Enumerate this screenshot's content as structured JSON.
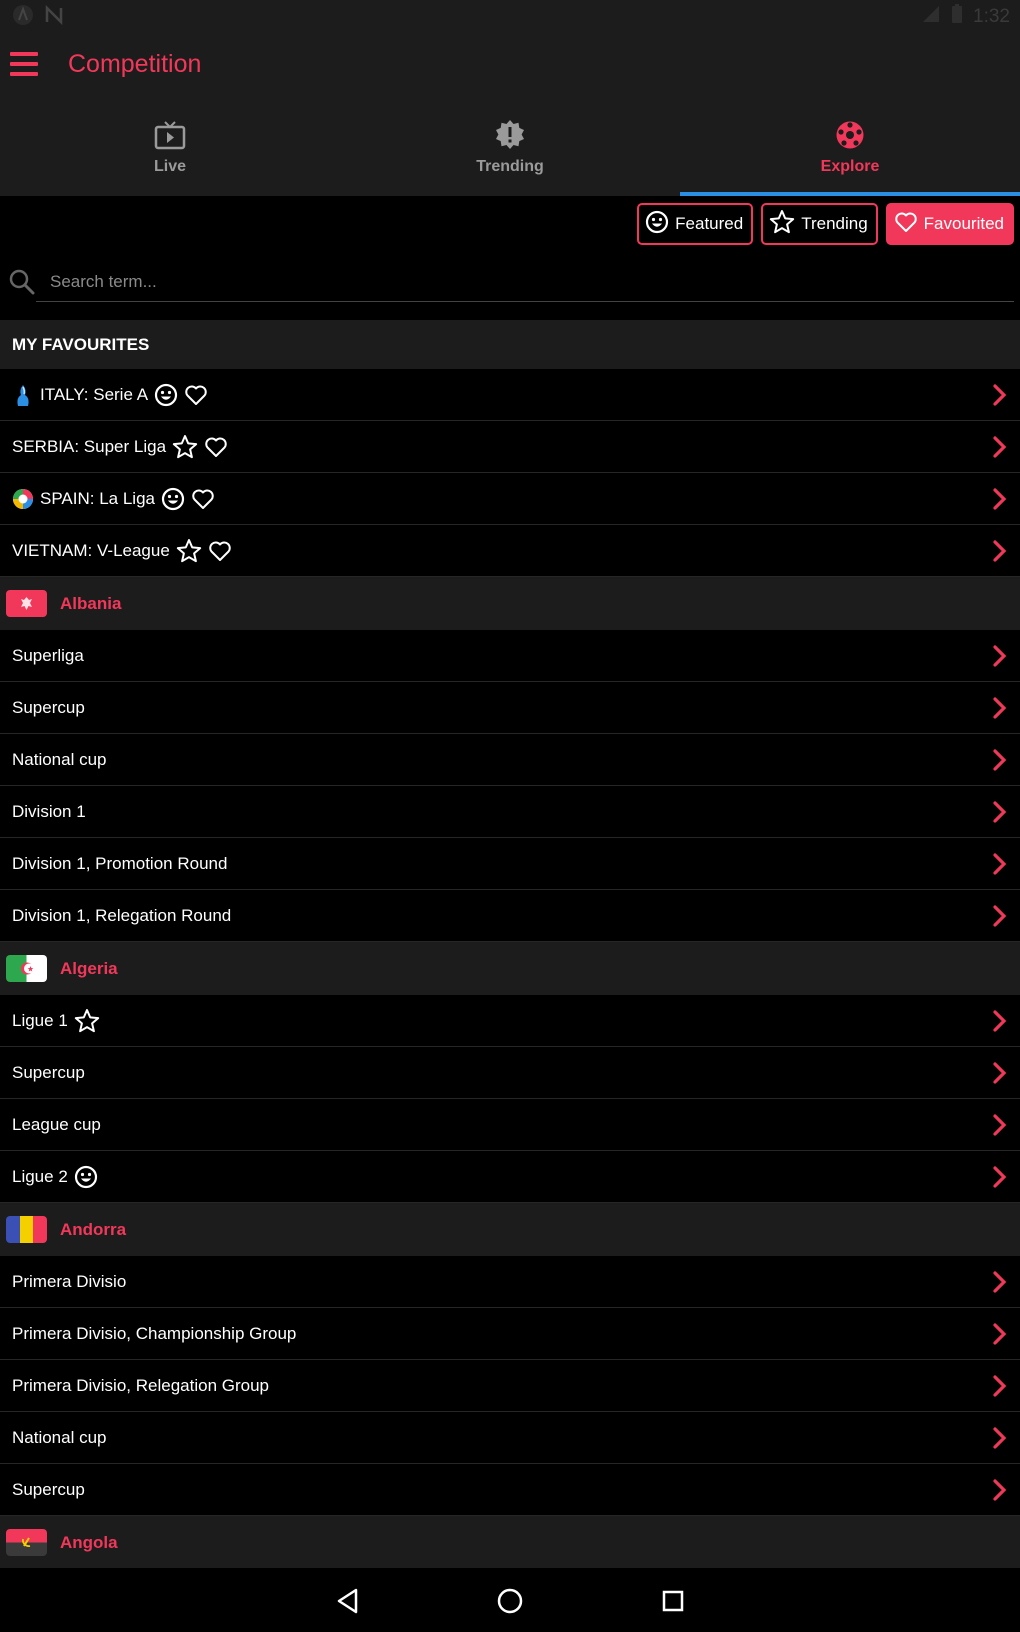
{
  "status_bar": {
    "time": "1:32"
  },
  "app_bar": {
    "title": "Competition"
  },
  "tabs": [
    {
      "label": "Live",
      "icon": "tv-icon"
    },
    {
      "label": "Trending",
      "icon": "alert-badge-icon"
    },
    {
      "label": "Explore",
      "icon": "soccer-ball-icon",
      "active": true
    }
  ],
  "filters": [
    {
      "label": "Featured",
      "icon": "smiley-icon"
    },
    {
      "label": "Trending",
      "icon": "star-icon"
    },
    {
      "label": "Favourited",
      "icon": "heart-icon",
      "active": true
    }
  ],
  "search": {
    "placeholder": "Search term..."
  },
  "favourites": {
    "header": "MY FAVOURITES",
    "items": [
      {
        "label": "ITALY: Serie A"
      },
      {
        "label": "SERBIA: Super Liga"
      },
      {
        "label": "SPAIN: La Liga"
      },
      {
        "label": "VIETNAM: V-League"
      }
    ]
  },
  "countries": [
    {
      "name": "Albania",
      "leagues": [
        "Superliga",
        "Supercup",
        "National cup",
        "Division 1",
        "Division 1, Promotion Round",
        "Division 1, Relegation Round"
      ]
    },
    {
      "name": "Algeria",
      "leagues": [
        "Ligue 1",
        "Supercup",
        "League cup",
        "Ligue 2"
      ]
    },
    {
      "name": "Andorra",
      "leagues": [
        "Primera Divisio",
        "Primera Divisio, Championship Group",
        "Primera Divisio, Relegation Group",
        "National cup",
        "Supercup"
      ]
    },
    {
      "name": "Angola",
      "leagues": []
    }
  ],
  "colors": {
    "accent": "#f2385a",
    "tab_indicator": "#2b8fe3",
    "surface": "#1c1c1c",
    "background": "#000000"
  }
}
